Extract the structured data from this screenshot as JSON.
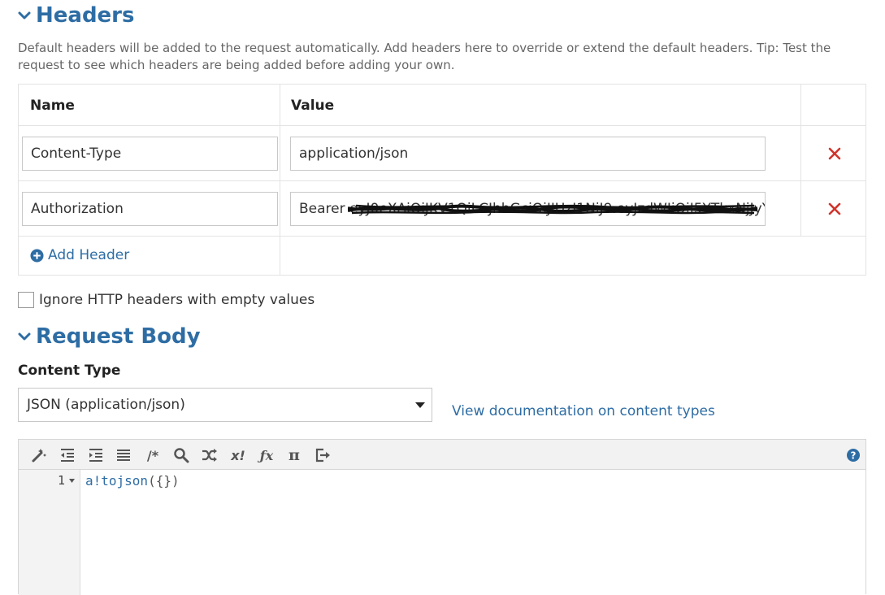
{
  "headers_section": {
    "title": "Headers",
    "helper_text": "Default headers will be added to the request automatically. Add headers here to override or extend the default headers. Tip: Test the request to see which headers are being added before adding your own.",
    "columns": {
      "name": "Name",
      "value": "Value"
    },
    "rows": [
      {
        "name": "Content-Type",
        "value": "application/json"
      },
      {
        "name": "Authorization",
        "value": "Bearer eyJ0eXAiOiJKV1QiLCJhbGciOiJIUzI1NiJ9.eyJzdWIiOiI5YTkxNjJyY3"
      }
    ],
    "add_label": "Add Header",
    "delete_color": "#d0342c"
  },
  "ignore_empty": {
    "label": "Ignore HTTP headers with empty values",
    "checked": false
  },
  "body_section": {
    "title": "Request Body",
    "content_type_label": "Content Type",
    "content_type_value": "JSON (application/json)",
    "doc_link": "View documentation on content types"
  },
  "editor": {
    "toolbar_icons": [
      "magic-wand-icon",
      "outdent-icon",
      "indent-icon",
      "list-icon",
      "comment-icon",
      "search-icon",
      "shuffle-icon",
      "x-factorial-icon",
      "function-icon",
      "pi-icon",
      "export-icon",
      "help-icon"
    ],
    "line_number": "1",
    "code_fn": "a!tojson",
    "code_args": "({})"
  },
  "colors": {
    "accent": "#2e6da4",
    "help": "#2e6da4"
  }
}
